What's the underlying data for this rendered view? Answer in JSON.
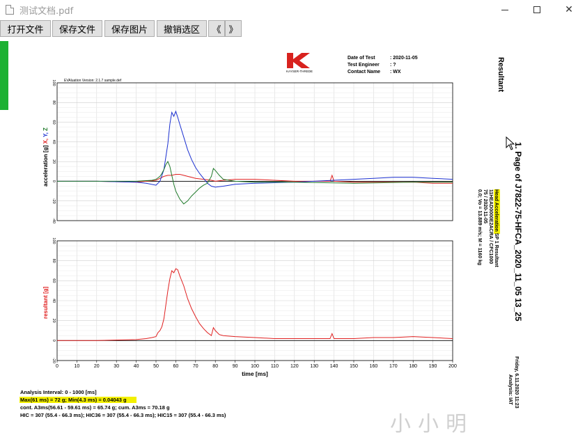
{
  "window": {
    "title": "测试文档.pdf",
    "controls": {
      "minimize": "minimize",
      "maximize": "maximize",
      "close": "✕"
    }
  },
  "toolbar": {
    "buttons": [
      "打开文件",
      "保存文件",
      "保存图片",
      "撤销选区",
      "《",
      "》"
    ]
  },
  "document": {
    "header": {
      "logo_text": "KAYSER-THREDE",
      "date_label": "Date of Test",
      "date_value": ": 2020-11-05",
      "engineer_label": "Test Engineer",
      "engineer_value": ": ?",
      "contact_label": "Contact Name",
      "contact_value": ": WX"
    },
    "eva_version": "EVAluation Version: 2.1.7 sample.def",
    "side_title": "Resultant",
    "page_title": "1. Page of J7822-75-HFCA_2020_11_05 13_25",
    "channel": {
      "name": "Head Acceleration",
      "suffix": " SP 1 Resultant",
      "code": "11HEAD0000E2ACRA / CFC1000",
      "test": "75 / 2020-11-05",
      "conditions": "0.0; Vo = 13.889 m/s; M = 1160 kg"
    },
    "footer_right": {
      "date": "Friday, 6.11.2020 11:23",
      "analysis": "Analysis: IAT"
    },
    "analysis": {
      "interval": "Analysis Interval:  0 - 1000 [ms]",
      "maxmin": "Max(61 ms) = 72 g; Min(4.3 ms) = 0.04043 g",
      "cont": "cont. A3ms(56.61 - 59.61 ms) = 65.74 g; cum. A3ms = 70.18 g",
      "hic": "HIC = 307 (55.4 - 66.3 ms); HIC36 = 307 (55.4 - 66.3 ms); HIC15 = 307 (55.4 - 66.3 ms)"
    },
    "watermark": "小小明"
  },
  "chart_data": [
    {
      "type": "line",
      "title": "",
      "xlabel": "",
      "ylabel": "acceleration [g]  X, Y, Z",
      "ylabel_parts": [
        "acceleration [g]",
        "X",
        "Y",
        "Z"
      ],
      "xlim": [
        0,
        200
      ],
      "ylim": [
        -40,
        100
      ],
      "yticks": [
        -40,
        -20,
        0,
        20,
        40,
        60,
        80,
        100
      ],
      "grid": true,
      "colors": {
        "X": "#e02020",
        "Y": "#1a2fd0",
        "Z": "#1f7a2a"
      },
      "series": [
        {
          "name": "X",
          "color": "#e02020",
          "x": [
            0,
            20,
            40,
            45,
            50,
            52,
            54,
            56,
            58,
            60,
            62,
            64,
            66,
            70,
            74,
            78,
            80,
            84,
            90,
            100,
            110,
            120,
            130,
            138,
            139,
            140,
            150,
            160,
            170,
            180,
            190,
            200
          ],
          "y": [
            0,
            0,
            -1,
            0,
            1,
            3,
            5,
            6,
            6,
            7,
            7,
            6,
            5,
            3,
            2,
            1,
            0,
            1,
            2,
            2,
            1,
            0,
            0,
            0,
            6,
            0,
            -1,
            -1,
            -1,
            -1,
            -2,
            -2
          ]
        },
        {
          "name": "Y",
          "color": "#1a2fd0",
          "x": [
            0,
            20,
            40,
            45,
            50,
            52,
            54,
            56,
            57,
            58,
            59,
            60,
            61,
            62,
            64,
            66,
            68,
            70,
            72,
            74,
            76,
            78,
            80,
            84,
            90,
            100,
            120,
            140,
            150,
            160,
            170,
            180,
            190,
            200
          ],
          "y": [
            0,
            0,
            -1,
            -2,
            -4,
            0,
            12,
            38,
            58,
            70,
            66,
            71,
            65,
            58,
            45,
            32,
            22,
            14,
            8,
            3,
            -2,
            -5,
            -6,
            -5,
            -3,
            -2,
            -1,
            1,
            2,
            3,
            4,
            4,
            3,
            2
          ]
        },
        {
          "name": "Z",
          "color": "#1f7a2a",
          "x": [
            0,
            20,
            40,
            48,
            50,
            52,
            53,
            54,
            55,
            56,
            57,
            58,
            59,
            60,
            62,
            64,
            66,
            68,
            70,
            72,
            74,
            76,
            78,
            79,
            80,
            82,
            84,
            90,
            100,
            120,
            150,
            180,
            200
          ],
          "y": [
            0,
            0,
            0,
            1,
            2,
            5,
            8,
            12,
            17,
            20,
            15,
            6,
            -3,
            -10,
            -18,
            -23,
            -20,
            -15,
            -11,
            -7,
            -4,
            -2,
            5,
            13,
            11,
            6,
            2,
            0,
            -1,
            -1,
            -2,
            -1,
            -1
          ]
        }
      ]
    },
    {
      "type": "line",
      "title": "",
      "xlabel": "time [ms]",
      "ylabel": "resultant [g]",
      "xlim": [
        0,
        200
      ],
      "ylim": [
        -20,
        100
      ],
      "xticks": [
        0,
        10,
        20,
        30,
        40,
        50,
        60,
        70,
        80,
        90,
        100,
        110,
        120,
        130,
        140,
        150,
        160,
        170,
        180,
        190,
        200
      ],
      "yticks": [
        -20,
        0,
        20,
        40,
        60,
        80,
        100
      ],
      "grid": true,
      "series": [
        {
          "name": "resultant",
          "color": "#e02020",
          "x": [
            0,
            20,
            40,
            45,
            48,
            50,
            51,
            52,
            53,
            54,
            55,
            56,
            57,
            58,
            59,
            60,
            61,
            62,
            64,
            66,
            68,
            70,
            72,
            74,
            76,
            78,
            79,
            80,
            82,
            84,
            90,
            100,
            110,
            120,
            130,
            138,
            139,
            140,
            150,
            160,
            170,
            180,
            190,
            200
          ],
          "y": [
            0,
            0,
            1,
            2,
            3,
            4,
            8,
            10,
            14,
            22,
            36,
            50,
            62,
            70,
            68,
            72,
            71,
            65,
            55,
            42,
            32,
            24,
            17,
            12,
            8,
            5,
            13,
            10,
            6,
            5,
            4,
            3,
            2,
            2,
            2,
            2,
            7,
            2,
            2,
            3,
            3,
            4,
            3,
            2
          ]
        }
      ]
    }
  ]
}
